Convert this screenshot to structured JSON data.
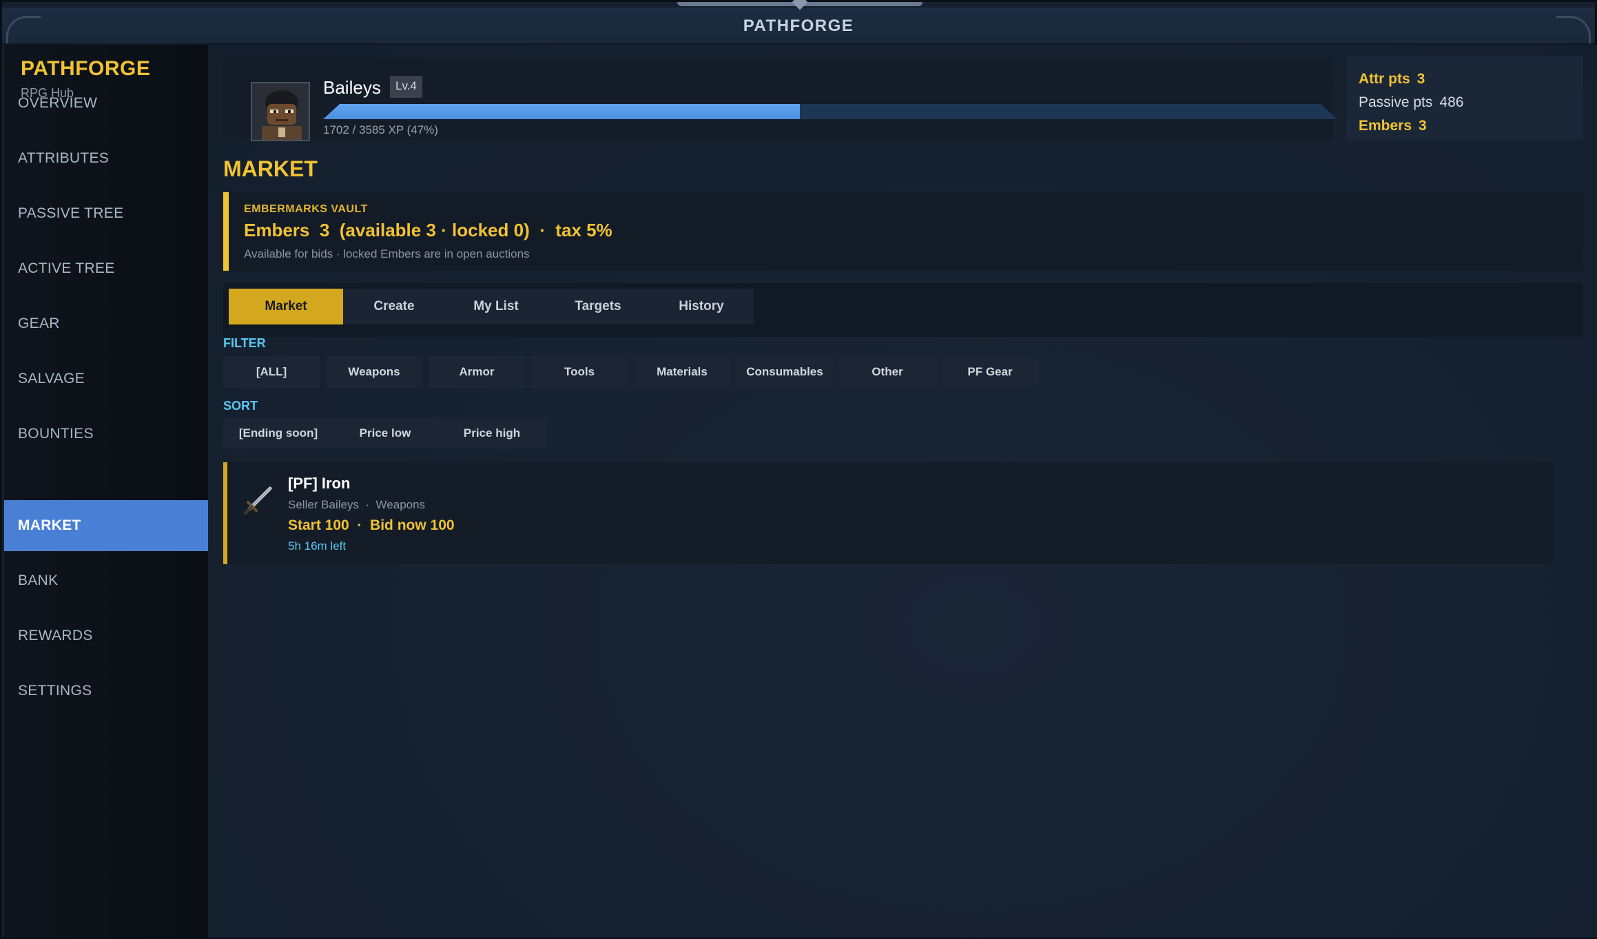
{
  "window": {
    "title": "PATHFORGE"
  },
  "sidebar": {
    "brand": "PATHFORGE",
    "subtitle": "RPG Hub",
    "items": [
      {
        "label": "OVERVIEW"
      },
      {
        "label": "ATTRIBUTES"
      },
      {
        "label": "PASSIVE TREE"
      },
      {
        "label": "ACTIVE TREE"
      },
      {
        "label": "GEAR"
      },
      {
        "label": "SALVAGE"
      },
      {
        "label": "BOUNTIES"
      },
      {
        "label": "MARKET",
        "active": true
      },
      {
        "label": "BANK"
      },
      {
        "label": "REWARDS"
      },
      {
        "label": "SETTINGS"
      }
    ]
  },
  "player": {
    "name": "Baileys",
    "level": "Lv.4",
    "xp_text": "1702 / 3585 XP (47%)",
    "xp_progress": 0.47
  },
  "stats": {
    "attr_label": "Attr pts",
    "attr_value": "3",
    "passive_label": "Passive pts",
    "passive_value": "486",
    "embers_label": "Embers",
    "embers_value": "3"
  },
  "market": {
    "title": "MARKET",
    "vault": {
      "label": "EMBERMARKS VAULT",
      "summary": "Embers  3  (available 3 · locked 0)  ·  tax 5%",
      "note": "Available for bids · locked Embers are in open auctions"
    },
    "tabs": [
      {
        "label": "Market",
        "active": true
      },
      {
        "label": "Create"
      },
      {
        "label": "My List"
      },
      {
        "label": "Targets"
      },
      {
        "label": "History"
      }
    ],
    "filter_label": "FILTER",
    "filters": [
      "[ALL]",
      "Weapons",
      "Armor",
      "Tools",
      "Materials",
      "Consumables",
      "Other",
      "PF Gear"
    ],
    "sort_label": "SORT",
    "sorts": [
      "[Ending soon]",
      "Price low",
      "Price high"
    ],
    "listings": [
      {
        "name": "[PF] Iron",
        "icon": "sword-icon",
        "meta": "Seller Baileys  ·  Weapons",
        "price": "Start 100  ·  Bid now 100",
        "time_left": "5h 16m left"
      }
    ]
  },
  "colors": {
    "accent_gold": "#f1c232",
    "active_nav": "#4a7fd6",
    "xp_fill": "#4a8fe0",
    "info_cyan": "#5bc6f0"
  }
}
